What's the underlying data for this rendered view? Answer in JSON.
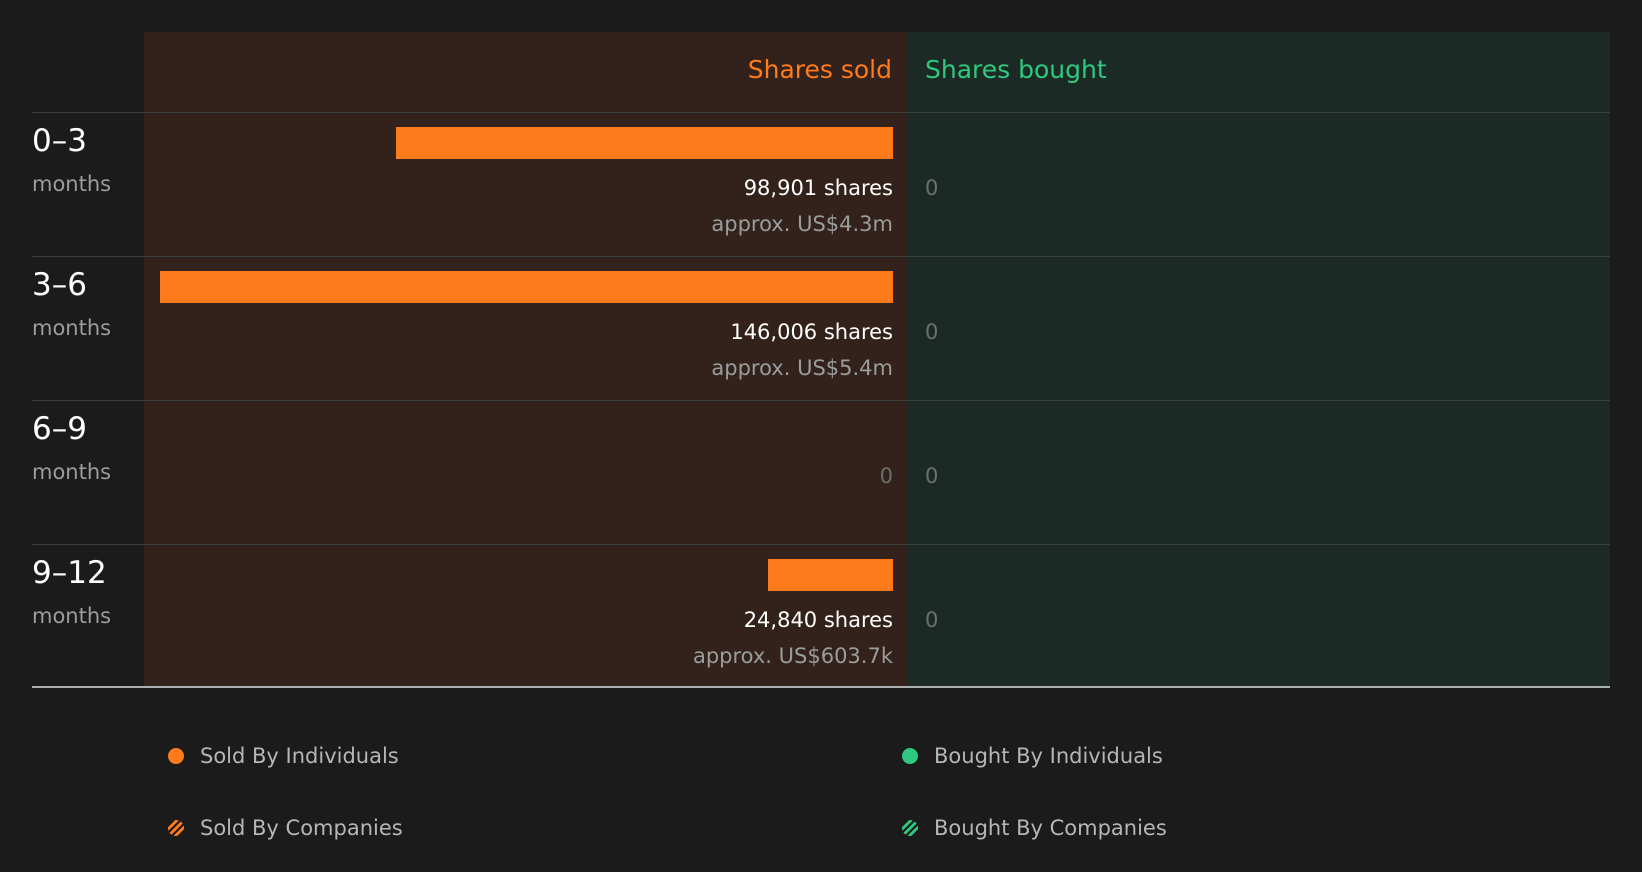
{
  "chart_data": {
    "type": "bar",
    "headers": {
      "sold": "Shares sold",
      "bought": "Shares bought"
    },
    "categories": [
      {
        "range": "0–3",
        "unit": "months"
      },
      {
        "range": "3–6",
        "unit": "months"
      },
      {
        "range": "6–9",
        "unit": "months"
      },
      {
        "range": "9–12",
        "unit": "months"
      }
    ],
    "series": [
      {
        "name": "Shares sold",
        "values": [
          98901,
          146006,
          0,
          24840
        ]
      },
      {
        "name": "Shares bought",
        "values": [
          0,
          0,
          0,
          0
        ]
      }
    ],
    "sold_labels": [
      {
        "shares": "98,901 shares",
        "approx": "approx. US$4.3m"
      },
      {
        "shares": "146,006 shares",
        "approx": "approx. US$5.4m"
      },
      {
        "zero": "0"
      },
      {
        "shares": "24,840 shares",
        "approx": "approx. US$603.7k"
      }
    ],
    "bought_labels": [
      "0",
      "0",
      "0",
      "0"
    ],
    "legend": [
      {
        "label": "Sold By Individuals",
        "style": "dot",
        "color": "#ff7a1a"
      },
      {
        "label": "Bought By Individuals",
        "style": "dot",
        "color": "#2dc97e"
      },
      {
        "label": "Sold By Companies",
        "style": "hatch",
        "color": "#ff7a1a"
      },
      {
        "label": "Bought By Companies",
        "style": "hatch",
        "color": "#2dc97e"
      }
    ],
    "colors": {
      "sold": "#ff7a1a",
      "bought": "#2dc97e"
    }
  }
}
